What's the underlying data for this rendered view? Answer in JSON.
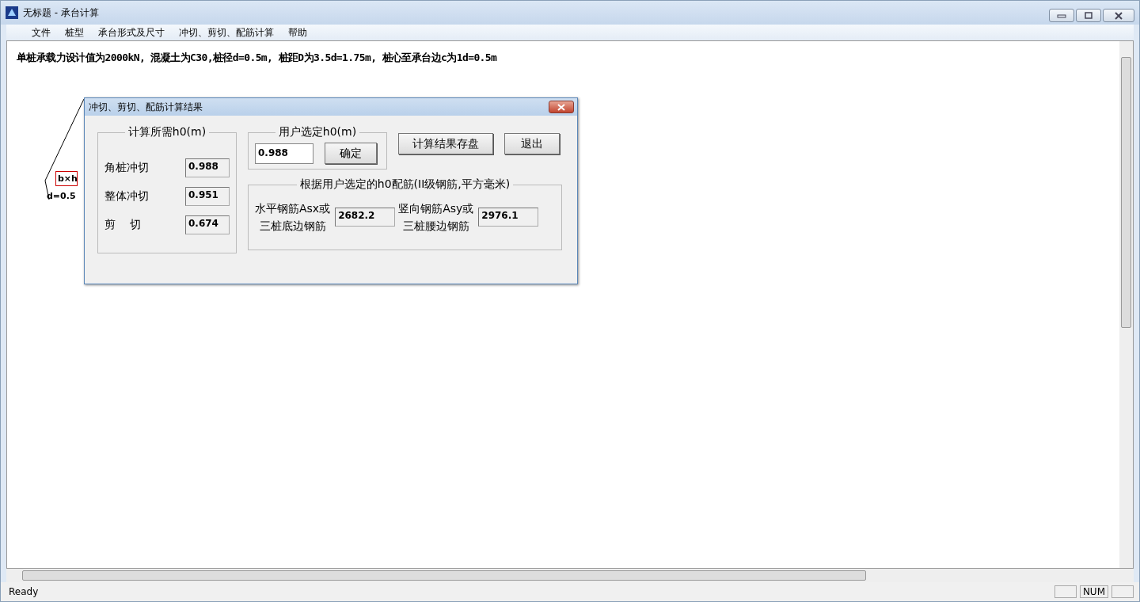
{
  "window": {
    "title": "无标题 - 承台计算"
  },
  "menu": [
    {
      "label": "文件"
    },
    {
      "label": "桩型"
    },
    {
      "label": "承台形式及尺寸"
    },
    {
      "label": "冲切、剪切、配筋计算"
    },
    {
      "label": "帮助"
    }
  ],
  "heading": "单桩承载力设计值为2000kN, 混凝土为C30,桩径d=0.5m, 桩距D为3.5d=1.75m, 桩心至承台边c为1d=0.5m",
  "drawing": {
    "box_label": "b×h",
    "diameter_label": "d=0.5"
  },
  "dialog": {
    "title": "冲切、剪切、配筋计算结果",
    "required": {
      "legend": "计算所需h0(m)",
      "items": [
        {
          "label": "角桩冲切",
          "value": "0.988"
        },
        {
          "label": "整体冲切",
          "value": "0.951"
        },
        {
          "label": "剪    切",
          "value": "0.674"
        }
      ]
    },
    "user": {
      "legend": "用户选定h0(m)",
      "value": "0.988",
      "button": "确定"
    },
    "buttons": [
      "计算结果存盘",
      "退出"
    ],
    "rebar": {
      "legend": "根据用户选定的h0配筋(II级钢筋,平方毫米)",
      "items": [
        {
          "lines": [
            "水平钢筋Asx或",
            "三桩底边钢筋"
          ],
          "value": "2682.2"
        },
        {
          "lines": [
            "竖向钢筋Asy或",
            "三桩腰边钢筋"
          ],
          "value": "2976.1"
        }
      ]
    }
  },
  "status_bar": {
    "text": "Ready",
    "indicator": "NUM"
  }
}
